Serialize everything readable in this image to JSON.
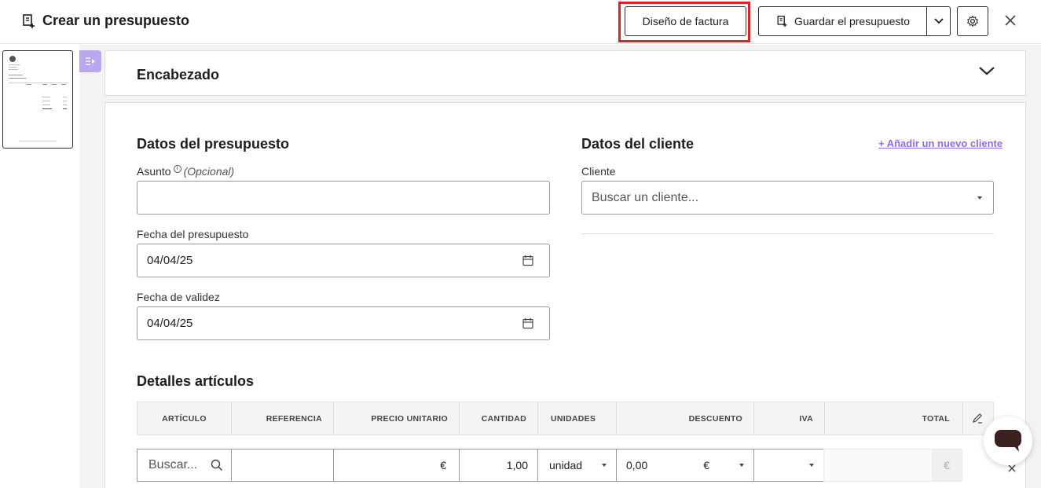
{
  "header": {
    "title": "Crear un presupuesto",
    "design_button": "Diseño de factura",
    "save_button": "Guardar el presupuesto"
  },
  "panel_header": {
    "title": "Encabezado"
  },
  "quote_data": {
    "title": "Datos del presupuesto",
    "subject_label": "Asunto",
    "subject_optional": "(Opcional)",
    "subject_value": "",
    "date_label": "Fecha del presupuesto",
    "date_value": "04/04/25",
    "validity_label": "Fecha de validez",
    "validity_value": "04/04/25"
  },
  "client_data": {
    "title": "Datos del cliente",
    "add_client_link": "+ Añadir un nuevo cliente",
    "client_label": "Cliente",
    "client_placeholder": "Buscar un cliente..."
  },
  "items": {
    "title": "Detalles artículos",
    "columns": [
      "ARTÍCULO",
      "REFERENCIA",
      "PRECIO UNITARIO",
      "CANTIDAD",
      "UNIDADES",
      "DESCUENTO",
      "IVA",
      "TOTAL"
    ],
    "row": {
      "article_placeholder": "Buscar...",
      "reference": "",
      "price_currency": "€",
      "quantity": "1,00",
      "unit": "unidad",
      "discount": "0,00",
      "discount_currency": "€",
      "total_currency": "€"
    }
  },
  "icons": {
    "doc": "document-add-icon",
    "gear": "gear-icon",
    "close": "close-icon",
    "chevron": "chevron-down-icon",
    "calendar": "calendar-icon",
    "search": "search-icon",
    "edit": "pencil-icon",
    "chat": "chat-icon"
  },
  "colors": {
    "accent": "#8b6ee6",
    "highlight": "#e02020",
    "toggle": "#b9a7ef"
  }
}
